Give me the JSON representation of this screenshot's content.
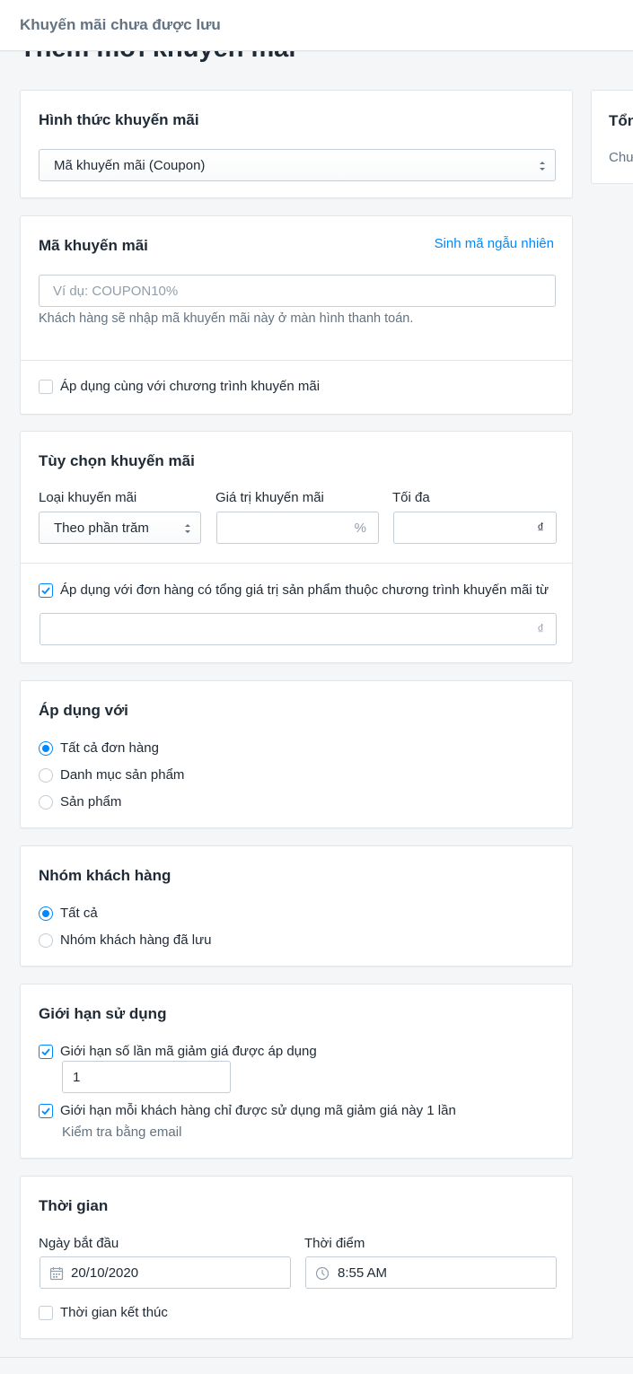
{
  "topbar": {
    "title": "Khuyến mãi chưa được lưu"
  },
  "page_title": "Thêm mới khuyến mãi",
  "side_summary": {
    "title": "Tổng",
    "text": "Chưa"
  },
  "promotion_type": {
    "heading": "Hình thức khuyến mãi",
    "selected": "Mã khuyến mãi (Coupon)"
  },
  "coupon": {
    "heading": "Mã khuyến mãi",
    "generate_link": "Sinh mã ngẫu nhiên",
    "placeholder": "Ví dụ: COUPON10%",
    "help": "Khách hàng sẽ nhập mã khuyến mãi này ở màn hình thanh toán.",
    "combine_label": "Áp dụng cùng với chương trình khuyến mãi",
    "combine_checked": false
  },
  "options": {
    "heading": "Tùy chọn khuyến mãi",
    "type_label": "Loại khuyến mãi",
    "type_value": "Theo phần trăm",
    "value_label": "Giá trị khuyến mãi",
    "value_suffix": "%",
    "max_label": "Tối đa",
    "max_suffix": "₫",
    "min_order_label": "Áp dụng với đơn hàng có tổng giá trị sản phẩm thuộc chương trình khuyến mãi từ",
    "min_order_checked": true,
    "min_order_suffix": "₫"
  },
  "apply_to": {
    "heading": "Áp dụng với",
    "options": [
      "Tất cả đơn hàng",
      "Danh mục sản phẩm",
      "Sản phẩm"
    ],
    "selected_index": 0
  },
  "customer_group": {
    "heading": "Nhóm khách hàng",
    "options": [
      "Tất cả",
      "Nhóm khách hàng đã lưu"
    ],
    "selected_index": 0
  },
  "usage_limit": {
    "heading": "Giới hạn sử dụng",
    "limit_total_label": "Giới hạn số lần mã giảm giá được áp dụng",
    "limit_total_checked": true,
    "limit_total_value": "1",
    "limit_per_customer_label": "Giới hạn mỗi khách hàng chỉ được sử dụng mã giảm giá này 1 lần",
    "limit_per_customer_checked": true,
    "limit_per_customer_help": "Kiểm tra bằng email"
  },
  "schedule": {
    "heading": "Thời gian",
    "start_date_label": "Ngày bắt đầu",
    "start_date_value": "20/10/2020",
    "start_time_label": "Thời điểm",
    "start_time_value": "8:55 AM",
    "end_time_label": "Thời gian kết thúc",
    "end_time_checked": false
  },
  "colors": {
    "accent": "#0088ff",
    "border": "#c4cdd5",
    "background": "#f4f6f8"
  }
}
